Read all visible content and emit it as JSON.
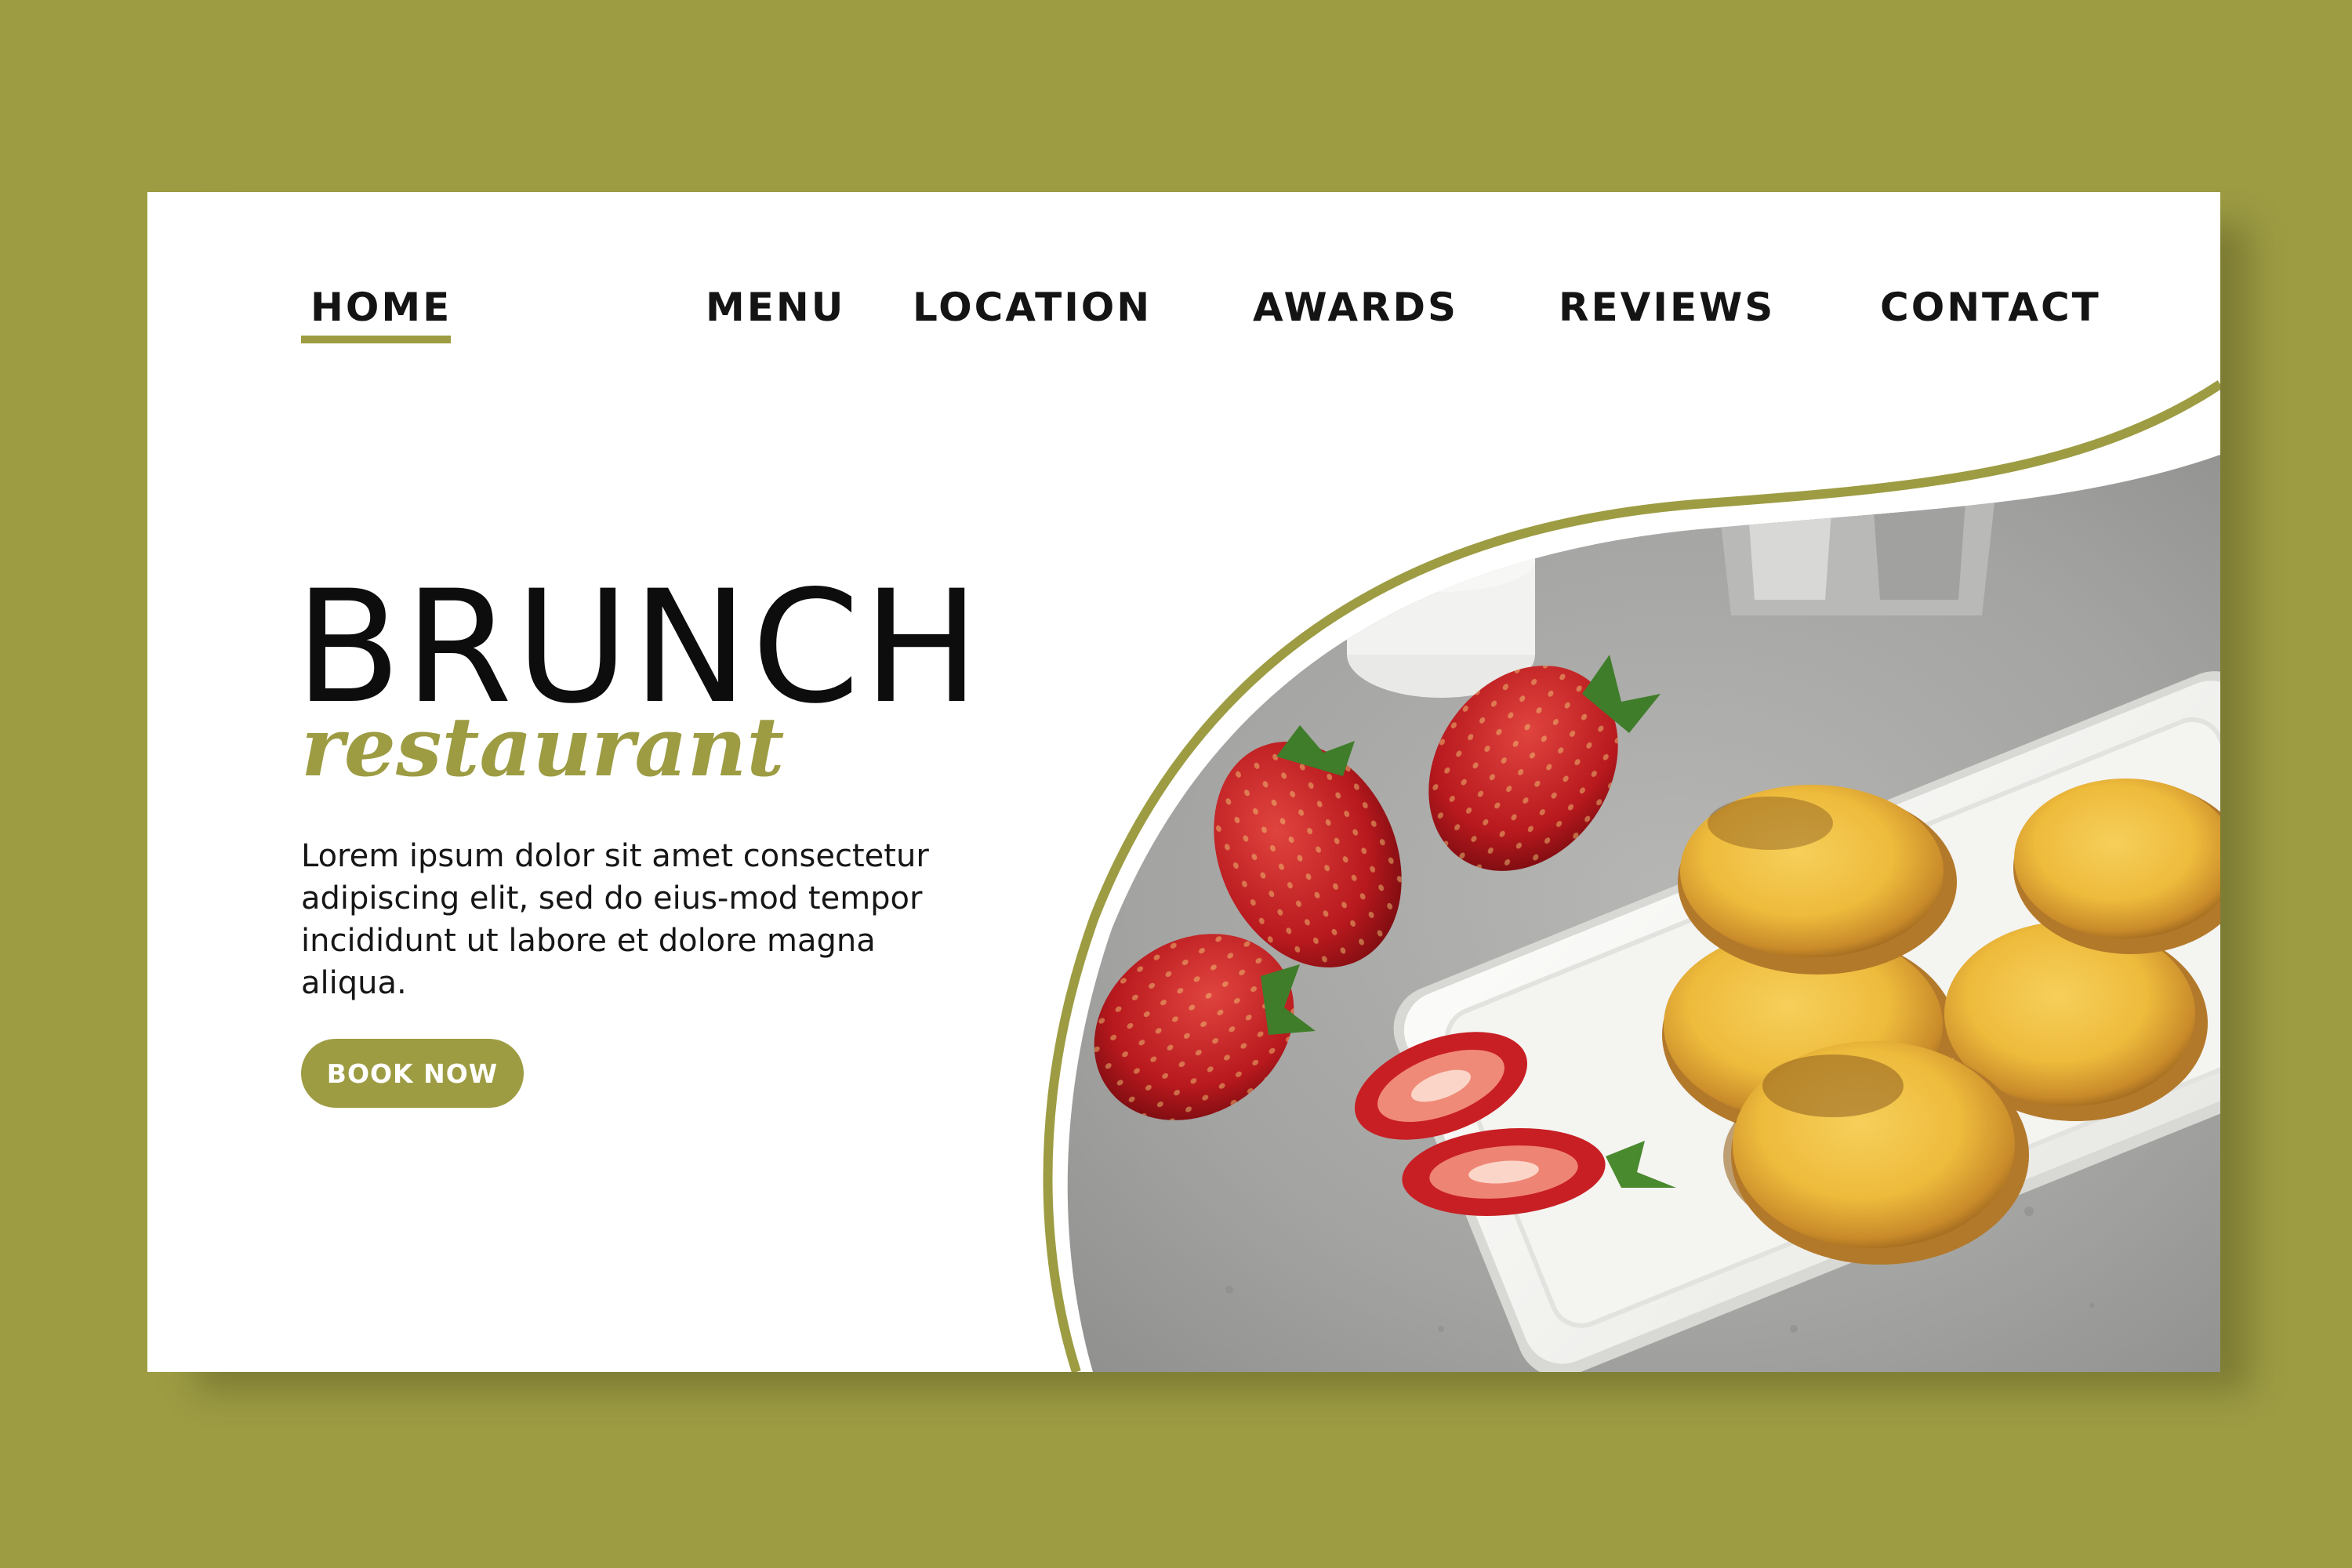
{
  "nav": {
    "items": [
      {
        "label": "HOME",
        "active": true
      },
      {
        "label": "MENU"
      },
      {
        "label": "LOCATION"
      },
      {
        "label": "AWARDS"
      },
      {
        "label": "REVIEWS"
      },
      {
        "label": "CONTACT"
      }
    ]
  },
  "hero": {
    "title": "BRUNCH",
    "subtitle": "restaurant",
    "body": "Lorem ipsum dolor sit amet consectetur adipiscing elit, sed do eius-mod tempor incididunt ut labore et dolore magna aliqua.",
    "button_label": "BOOK NOW"
  },
  "colors": {
    "accent": "#9d9c43",
    "card": "#ffffff",
    "text": "#141414"
  },
  "photo": {
    "subject": "pancakes-and-strawberries-photo"
  }
}
